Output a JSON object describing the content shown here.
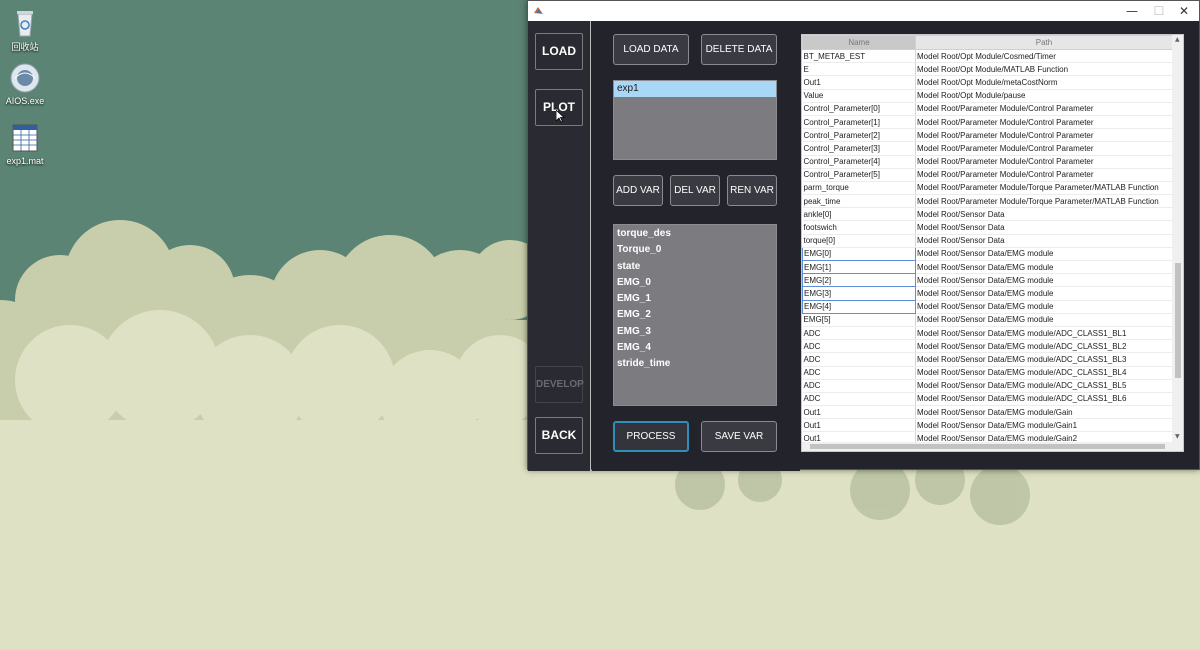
{
  "desktop": {
    "icons": [
      {
        "label": "回收站",
        "icon": "recycle-bin-icon"
      },
      {
        "label": "AIOS.exe",
        "icon": "app-globe-icon"
      },
      {
        "label": "exp1.mat",
        "icon": "spreadsheet-file-icon"
      }
    ]
  },
  "window": {
    "controls": {
      "minimize": "—",
      "maximize": "☐",
      "close": "✕"
    },
    "sidebar": {
      "load": "LOAD",
      "plot": "PLOT",
      "develop": "DEVELOP",
      "back": "BACK"
    },
    "data_panel": {
      "load_data": "LOAD DATA",
      "delete_data": "DELETE DATA",
      "datasets": [
        "exp1"
      ],
      "selected_dataset": "exp1",
      "add_var": "ADD VAR",
      "del_var": "DEL VAR",
      "ren_var": "REN VAR",
      "variables": [
        "torque_des",
        "Torque_0",
        "state",
        "EMG_0",
        "EMG_1",
        "EMG_2",
        "EMG_3",
        "EMG_4",
        "stride_time"
      ],
      "process": "PROCESS",
      "save_var": "SAVE VAR"
    },
    "table": {
      "columns": [
        "Name",
        "Path"
      ],
      "rows": [
        [
          "BT_METAB_EST",
          "Model Root/Opt Module/Cosmed/Timer"
        ],
        [
          "E",
          "Model Root/Opt Module/MATLAB Function"
        ],
        [
          "Out1",
          "Model Root/Opt Module/metaCostNorm"
        ],
        [
          "Value",
          "Model Root/Opt Module/pause"
        ],
        [
          "Control_Parameter[0]",
          "Model Root/Parameter Module/Control Parameter"
        ],
        [
          "Control_Parameter[1]",
          "Model Root/Parameter Module/Control Parameter"
        ],
        [
          "Control_Parameter[2]",
          "Model Root/Parameter Module/Control Parameter"
        ],
        [
          "Control_Parameter[3]",
          "Model Root/Parameter Module/Control Parameter"
        ],
        [
          "Control_Parameter[4]",
          "Model Root/Parameter Module/Control Parameter"
        ],
        [
          "Control_Parameter[5]",
          "Model Root/Parameter Module/Control Parameter"
        ],
        [
          "parm_torque",
          "Model Root/Parameter Module/Torque Parameter/MATLAB Function"
        ],
        [
          "peak_time",
          "Model Root/Parameter Module/Torque Parameter/MATLAB Function"
        ],
        [
          "ankle[0]",
          "Model Root/Sensor Data"
        ],
        [
          "footswich",
          "Model Root/Sensor Data"
        ],
        [
          "torque[0]",
          "Model Root/Sensor Data"
        ],
        [
          "EMG[0]",
          "Model Root/Sensor Data/EMG module"
        ],
        [
          "EMG[1]",
          "Model Root/Sensor Data/EMG module"
        ],
        [
          "EMG[2]",
          "Model Root/Sensor Data/EMG module"
        ],
        [
          "EMG[3]",
          "Model Root/Sensor Data/EMG module"
        ],
        [
          "EMG[4]",
          "Model Root/Sensor Data/EMG module"
        ],
        [
          "EMG[5]",
          "Model Root/Sensor Data/EMG module"
        ],
        [
          "ADC",
          "Model Root/Sensor Data/EMG module/ADC_CLASS1_BL1"
        ],
        [
          "ADC",
          "Model Root/Sensor Data/EMG module/ADC_CLASS1_BL2"
        ],
        [
          "ADC",
          "Model Root/Sensor Data/EMG module/ADC_CLASS1_BL3"
        ],
        [
          "ADC",
          "Model Root/Sensor Data/EMG module/ADC_CLASS1_BL4"
        ],
        [
          "ADC",
          "Model Root/Sensor Data/EMG module/ADC_CLASS1_BL5"
        ],
        [
          "ADC",
          "Model Root/Sensor Data/EMG module/ADC_CLASS1_BL6"
        ],
        [
          "Out1",
          "Model Root/Sensor Data/EMG module/Gain"
        ],
        [
          "Out1",
          "Model Root/Sensor Data/EMG module/Gain1"
        ],
        [
          "Out1",
          "Model Root/Sensor Data/EMG module/Gain2"
        ]
      ],
      "boxed_rows": [
        15,
        16,
        17,
        18,
        19
      ]
    }
  }
}
